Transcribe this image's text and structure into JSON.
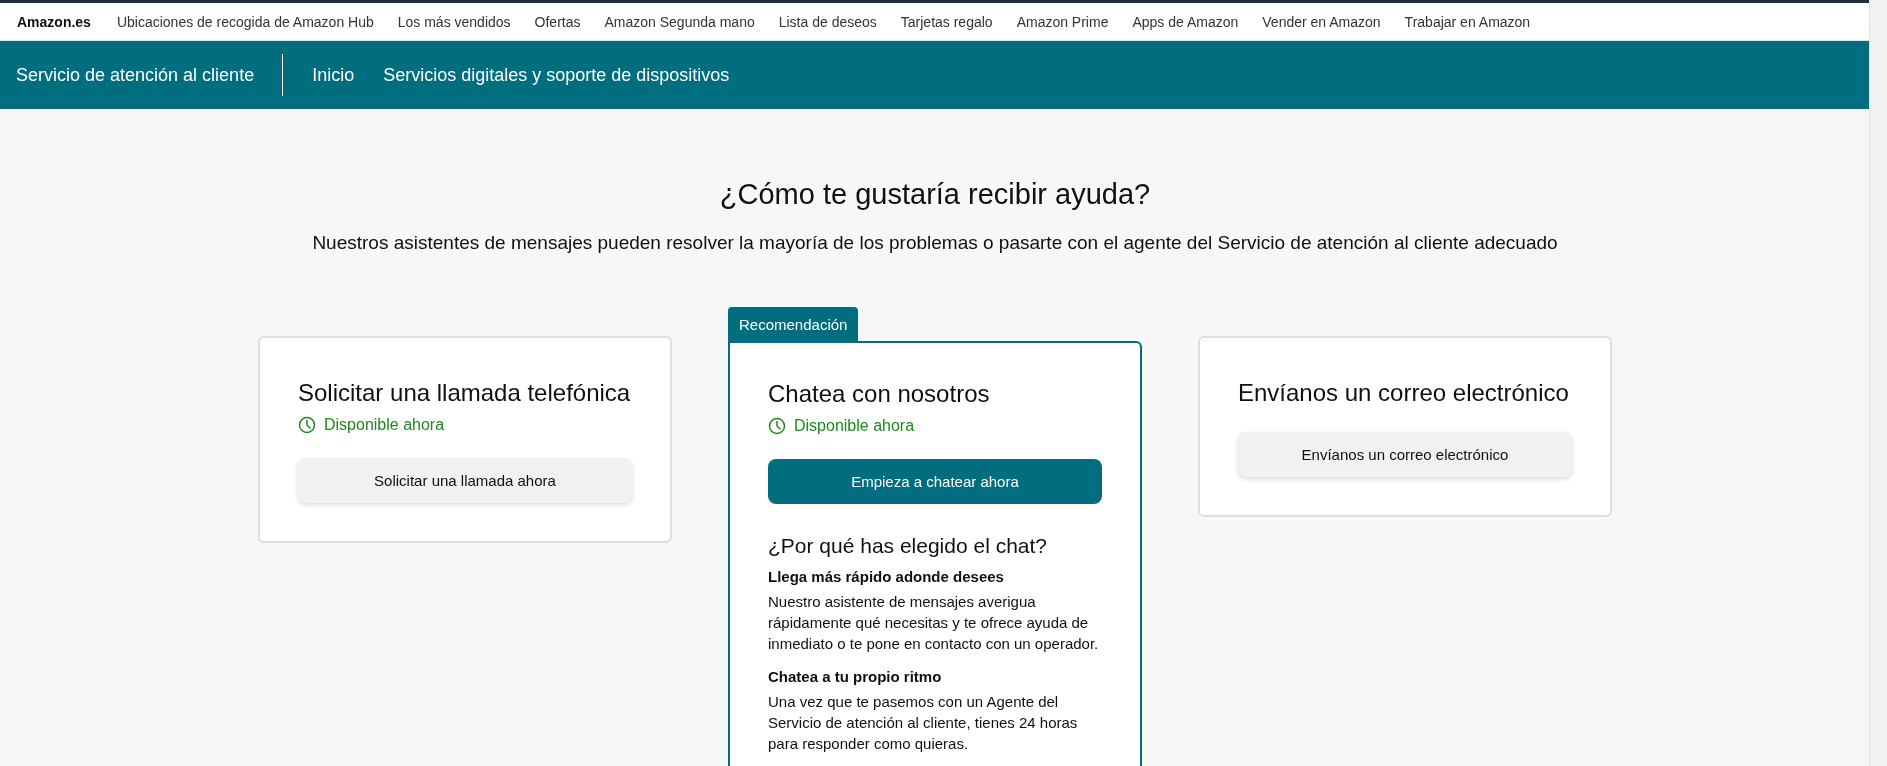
{
  "top_nav": [
    {
      "label": "Amazon.es",
      "kind": "logo"
    },
    {
      "label": "Ubicaciones de recogida de Amazon Hub",
      "kind": "link"
    },
    {
      "label": "Los más vendidos",
      "kind": "link"
    },
    {
      "label": "Ofertas",
      "kind": "link"
    },
    {
      "label": "Amazon Segunda mano",
      "kind": "link"
    },
    {
      "label": "Lista de deseos",
      "kind": "link"
    },
    {
      "label": "Tarjetas regalo",
      "kind": "link"
    },
    {
      "label": "Amazon Prime",
      "kind": "link"
    },
    {
      "label": "Apps de Amazon",
      "kind": "link"
    },
    {
      "label": "Vender en Amazon",
      "kind": "link"
    },
    {
      "label": "Trabajar en Amazon",
      "kind": "link"
    }
  ],
  "header": {
    "title": "Servicio de atención al cliente",
    "links": [
      "Inicio",
      "Servicios digitales y soporte de dispositivos"
    ]
  },
  "heading": "¿Cómo te gustaría recibir ayuda?",
  "subheading": "Nuestros asistentes de mensajes pueden resolver la mayoría de los problemas o pasarte con el agente del Servicio de atención al cliente adecuado",
  "options": [
    {
      "title": "Solicitar una llamada telefónica",
      "status": "Disponible ahora",
      "button": {
        "label": "Solicitar una llamada ahora",
        "primary": false
      }
    },
    {
      "badge": "Recomendación",
      "title": "Chatea con nosotros",
      "status": "Disponible ahora",
      "button": {
        "label": "Empieza a chatear ahora",
        "primary": true
      },
      "why": {
        "title": "¿Por qué has elegido el chat?",
        "reasons": [
          {
            "title": "Llega más rápido adonde desees",
            "text": "Nuestro asistente de mensajes averigua rápidamente qué necesitas y te ofrece ayuda de inmediato o te pone en contacto con un operador."
          },
          {
            "title": "Chatea a tu propio ritmo",
            "text": "Una vez que te pasemos con un Agente del Servicio de atención al cliente, tienes 24 horas para responder como quieras."
          }
        ]
      }
    },
    {
      "title": "Envíanos un correo electrónico",
      "button": {
        "label": "Envíanos un correo electrónico",
        "primary": false
      }
    }
  ]
}
